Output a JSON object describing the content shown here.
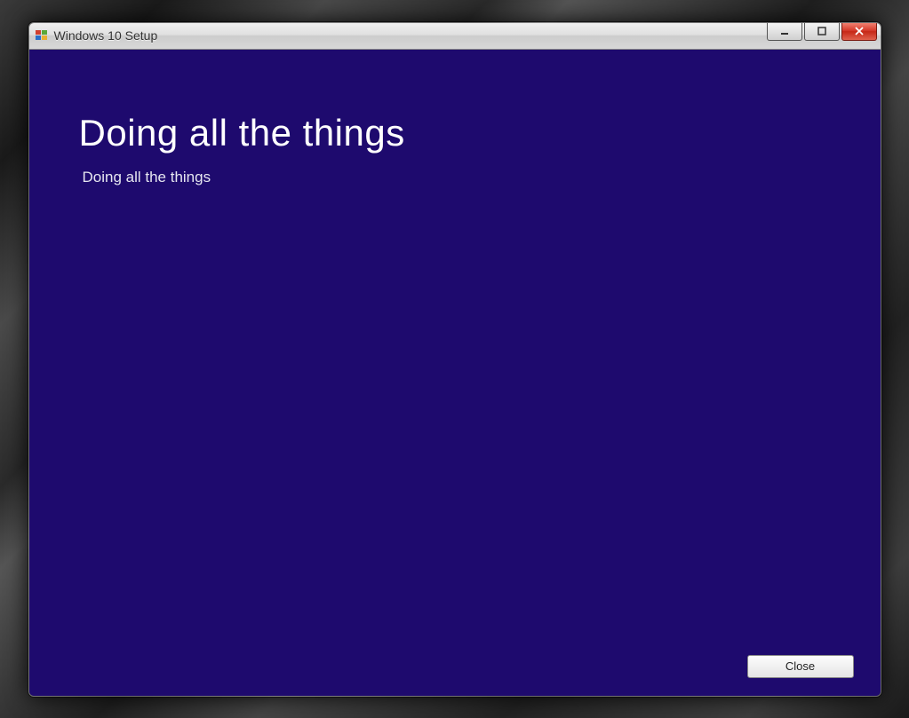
{
  "window": {
    "title": "Windows 10 Setup"
  },
  "content": {
    "heading": "Doing all the things",
    "subtext": "Doing all the things"
  },
  "footer": {
    "close_label": "Close"
  }
}
